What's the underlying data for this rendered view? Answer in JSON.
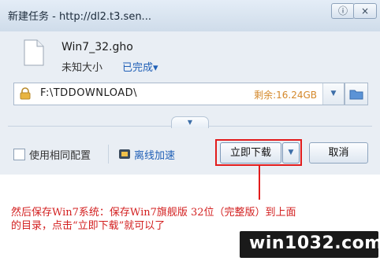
{
  "window": {
    "title": "新建任务 - http://dl2.t3.sen...",
    "controls": [
      "ⓘ",
      "×"
    ]
  },
  "file": {
    "name": "Win7_32.gho",
    "size": "未知大小",
    "status": "已完成",
    "status_arrow": "▾"
  },
  "save_path": {
    "path": "F:\\TDDOWNLOAD\\",
    "free_space": "剩余:16.24GB",
    "dropdown_arrow": "▼"
  },
  "options": {
    "expand_arrow": "▼",
    "same_config_label": "使用相同配置",
    "same_config_checked": false,
    "offline_label": "离线加速"
  },
  "buttons": {
    "download_now": "立即下载",
    "download_arrow": "▼",
    "cancel": "取消"
  },
  "annotation": {
    "line1": "然后保存Win7系统：保存Win7旗舰版 32位（完整版）到上面",
    "line2": "的目录，点击“立即下载”就可以了"
  },
  "watermark": {
    "text": "win1032.com"
  },
  "colors": {
    "accent_blue": "#1f5fb6",
    "free_space_orange": "#d4882a",
    "highlight_red": "#e21c1c"
  },
  "icons": [
    "file-icon",
    "lock-icon",
    "folder-icon",
    "offline-speed-icon"
  ]
}
